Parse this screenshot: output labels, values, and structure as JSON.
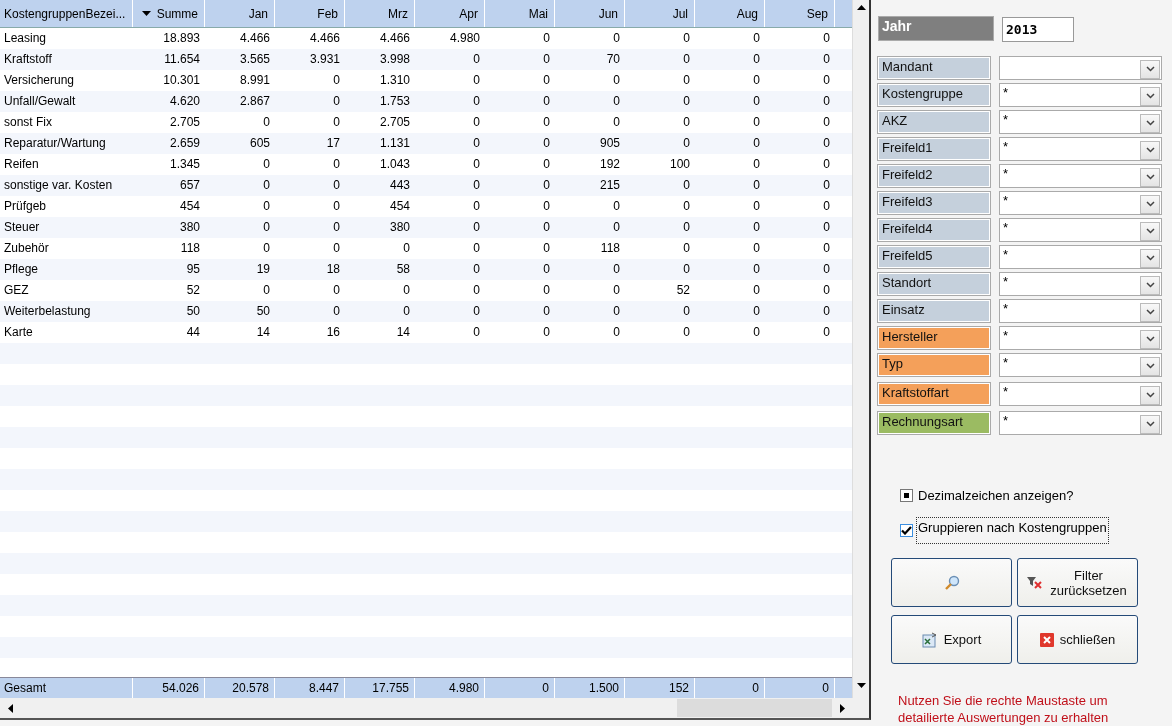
{
  "table": {
    "columns": [
      {
        "label": "KostengruppenBezei...",
        "sorted": false
      },
      {
        "label": "Summe",
        "sorted": true
      },
      {
        "label": "Jan",
        "sorted": false
      },
      {
        "label": "Feb",
        "sorted": false
      },
      {
        "label": "Mrz",
        "sorted": false
      },
      {
        "label": "Apr",
        "sorted": false
      },
      {
        "label": "Mai",
        "sorted": false
      },
      {
        "label": "Jun",
        "sorted": false
      },
      {
        "label": "Jul",
        "sorted": false
      },
      {
        "label": "Aug",
        "sorted": false
      },
      {
        "label": "Sep",
        "sorted": false
      }
    ],
    "rows": [
      [
        "Leasing",
        "18.893",
        "4.466",
        "4.466",
        "4.466",
        "4.980",
        "0",
        "0",
        "0",
        "0",
        "0"
      ],
      [
        "Kraftstoff",
        "11.654",
        "3.565",
        "3.931",
        "3.998",
        "0",
        "0",
        "70",
        "0",
        "0",
        "0"
      ],
      [
        "Versicherung",
        "10.301",
        "8.991",
        "0",
        "1.310",
        "0",
        "0",
        "0",
        "0",
        "0",
        "0"
      ],
      [
        "Unfall/Gewalt",
        "4.620",
        "2.867",
        "0",
        "1.753",
        "0",
        "0",
        "0",
        "0",
        "0",
        "0"
      ],
      [
        "sonst Fix",
        "2.705",
        "0",
        "0",
        "2.705",
        "0",
        "0",
        "0",
        "0",
        "0",
        "0"
      ],
      [
        "Reparatur/Wartung",
        "2.659",
        "605",
        "17",
        "1.131",
        "0",
        "0",
        "905",
        "0",
        "0",
        "0"
      ],
      [
        "Reifen",
        "1.345",
        "0",
        "0",
        "1.043",
        "0",
        "0",
        "192",
        "100",
        "0",
        "0"
      ],
      [
        "sonstige var. Kosten",
        "657",
        "0",
        "0",
        "443",
        "0",
        "0",
        "215",
        "0",
        "0",
        "0"
      ],
      [
        "Prüfgeb",
        "454",
        "0",
        "0",
        "454",
        "0",
        "0",
        "0",
        "0",
        "0",
        "0"
      ],
      [
        "Steuer",
        "380",
        "0",
        "0",
        "380",
        "0",
        "0",
        "0",
        "0",
        "0",
        "0"
      ],
      [
        "Zubehör",
        "118",
        "0",
        "0",
        "0",
        "0",
        "0",
        "118",
        "0",
        "0",
        "0"
      ],
      [
        "Pflege",
        "95",
        "19",
        "18",
        "58",
        "0",
        "0",
        "0",
        "0",
        "0",
        "0"
      ],
      [
        "GEZ",
        "52",
        "0",
        "0",
        "0",
        "0",
        "0",
        "0",
        "52",
        "0",
        "0"
      ],
      [
        "Weiterbelastung",
        "50",
        "50",
        "0",
        "0",
        "0",
        "0",
        "0",
        "0",
        "0",
        "0"
      ],
      [
        "Karte",
        "44",
        "14",
        "16",
        "14",
        "0",
        "0",
        "0",
        "0",
        "0",
        "0"
      ]
    ],
    "totals": [
      "Gesamt",
      "54.026",
      "20.578",
      "8.447",
      "17.755",
      "4.980",
      "0",
      "1.500",
      "152",
      "0",
      "0"
    ]
  },
  "year": {
    "label": "Jahr",
    "value": "2013"
  },
  "filters": [
    {
      "label": "Mandant",
      "color": "#c5d0dc"
    },
    {
      "label": "Kostengruppe",
      "value": "*",
      "color": "#c5d0dc"
    },
    {
      "label": "AKZ",
      "value": "*",
      "color": "#c5d0dc"
    },
    {
      "label": "Freifeld1",
      "value": "*",
      "color": "#c5d0dc"
    },
    {
      "label": "Freifeld2",
      "value": "*",
      "color": "#c5d0dc"
    },
    {
      "label": "Freifeld3",
      "value": "*",
      "color": "#c5d0dc"
    },
    {
      "label": "Freifeld4",
      "value": "*",
      "color": "#c5d0dc"
    },
    {
      "label": "Freifeld5",
      "value": "*",
      "color": "#c5d0dc"
    },
    {
      "label": "Standort",
      "value": "*",
      "color": "#c5d0dc"
    },
    {
      "label": "Einsatz",
      "value": "*",
      "color": "#c5d0dc"
    },
    {
      "label": "Hersteller",
      "value": "*",
      "color": "#f4a05a"
    },
    {
      "label": "Typ",
      "value": "*",
      "color": "#f4a05a"
    },
    {
      "label": "Kraftstoffart",
      "value": "*",
      "color": "#f4a05a"
    },
    {
      "label": "Rechnungsart",
      "value": "*",
      "color": "#9bbb62"
    }
  ],
  "options": [
    {
      "label": "Dezimalzeichen anzeigen?",
      "checked": false,
      "indeterminate": true,
      "focused": false
    },
    {
      "label": "Gruppieren nach Kostengruppen",
      "checked": true,
      "indeterminate": false,
      "focused": true
    }
  ],
  "buttons": [
    {
      "kind": "search"
    },
    {
      "kind": "reset",
      "label": "Filter zurücksetzen"
    },
    {
      "kind": "export",
      "label": "Export"
    },
    {
      "kind": "close",
      "label": "schließen"
    }
  ],
  "hint": "Nutzen Sie die rechte Maustaste um detailierte Auswertungen zu erhalten"
}
